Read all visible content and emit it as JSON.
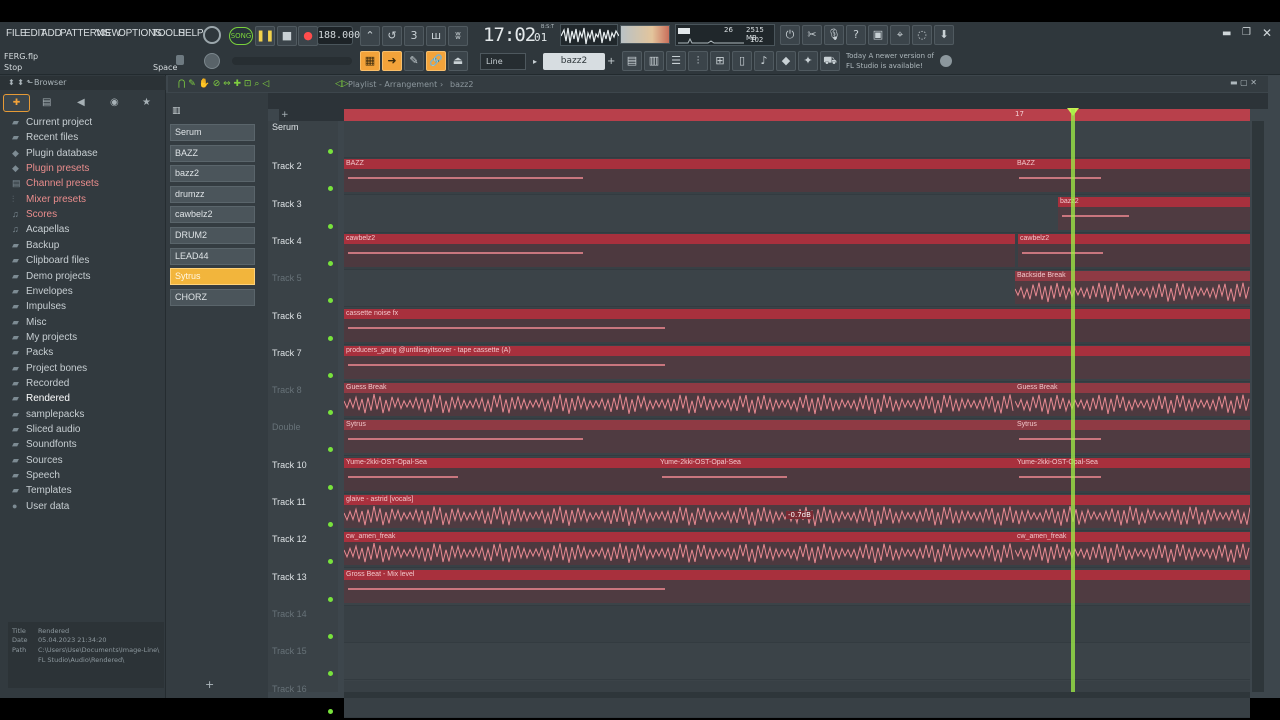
{
  "menu": [
    "FILE",
    "EDIT",
    "ADD",
    "PATTERNS",
    "VIEW",
    "OPTIONS",
    "TOOLS",
    "HELP"
  ],
  "transport": {
    "mode": "SONG",
    "tempo": "188.000",
    "time_main": "17:02",
    "time_sub": "01",
    "time_label": "B:S:T",
    "cpu": "26",
    "memory": "2515 MB",
    "polyphony": "102"
  },
  "hint": {
    "file": "FERG.flp",
    "action": "Stop",
    "shortcut": "Space"
  },
  "hint_panel": {
    "line1": "Today  A newer version of",
    "line2": "FL Studio is available!"
  },
  "snap": {
    "value": "Line"
  },
  "pattern_selector": {
    "value": "bazz2"
  },
  "browser": {
    "title": "Browser",
    "items": [
      {
        "label": "Current project",
        "icon": "folder-icon",
        "hl": false
      },
      {
        "label": "Recent files",
        "icon": "folder-icon",
        "hl": false
      },
      {
        "label": "Plugin database",
        "icon": "plugin-icon",
        "hl": false
      },
      {
        "label": "Plugin presets",
        "icon": "plugin-icon",
        "hl": true
      },
      {
        "label": "Channel presets",
        "icon": "channel-icon",
        "hl": true
      },
      {
        "label": "Mixer presets",
        "icon": "mixer-icon",
        "hl": true
      },
      {
        "label": "Scores",
        "icon": "music-icon",
        "hl": true
      },
      {
        "label": "Acapellas",
        "icon": "music-icon",
        "hl": false
      },
      {
        "label": "Backup",
        "icon": "folder-icon",
        "hl": false
      },
      {
        "label": "Clipboard files",
        "icon": "folder-icon",
        "hl": false
      },
      {
        "label": "Demo projects",
        "icon": "folder-icon",
        "hl": false
      },
      {
        "label": "Envelopes",
        "icon": "folder-icon",
        "hl": false
      },
      {
        "label": "Impulses",
        "icon": "folder-icon",
        "hl": false
      },
      {
        "label": "Misc",
        "icon": "folder-icon",
        "hl": false
      },
      {
        "label": "My projects",
        "icon": "folder-icon",
        "hl": false
      },
      {
        "label": "Packs",
        "icon": "folder-icon",
        "hl": false
      },
      {
        "label": "Project bones",
        "icon": "folder-icon",
        "hl": false
      },
      {
        "label": "Recorded",
        "icon": "folder-icon",
        "hl": false
      },
      {
        "label": "Rendered",
        "icon": "folder-icon",
        "hl": false,
        "sel": true
      },
      {
        "label": "samplepacks",
        "icon": "folder-icon",
        "hl": false
      },
      {
        "label": "Sliced audio",
        "icon": "folder-icon",
        "hl": false
      },
      {
        "label": "Soundfonts",
        "icon": "folder-icon",
        "hl": false
      },
      {
        "label": "Sources",
        "icon": "folder-icon",
        "hl": false
      },
      {
        "label": "Speech",
        "icon": "folder-icon",
        "hl": false
      },
      {
        "label": "Templates",
        "icon": "folder-icon",
        "hl": false
      },
      {
        "label": "User data",
        "icon": "user-icon",
        "hl": false
      }
    ],
    "info": {
      "title_label": "Title",
      "title_value": "Rendered",
      "date_label": "Date",
      "date_value": "05.04.2023 21:34:20",
      "path_label": "Path",
      "path_value1": "C:\\Users\\Use\\Documents\\Image-Line\\",
      "path_value2": "FL Studio\\Audio\\Rendered\\"
    }
  },
  "patterns": [
    "Serum",
    "BAZZ",
    "bazz2",
    "drumzz",
    "cawbelz2",
    "DRUM2",
    "LEAD44",
    "Sytrus",
    "CHORZ"
  ],
  "selected_pattern": "Sytrus",
  "playlist": {
    "title": "Playlist - Arrangement",
    "crumb": "bazz2",
    "ruler_marker": "17",
    "tracks": [
      "Serum",
      "Track 2",
      "Track 3",
      "Track 4",
      "Track 5",
      "Track 6",
      "Track 7",
      "Track 8",
      "Double",
      "Track 10",
      "Track 11",
      "Track 12",
      "Track 13",
      "Track 14",
      "Track 15",
      "Track 16"
    ],
    "clip_labels": {
      "bazz": "BAZZ",
      "bazz2": "bazz2",
      "cawbelz2": "cawbelz2",
      "backside": "Backside Break",
      "cassette": "cassette noise fx",
      "producers": "producers_gang @untilisayitsover - tape cassette (A)",
      "guess": "Guess Break",
      "sytrus": "Sytrus",
      "yume": "Yume-2kki-OST-Opal-Sea",
      "opal": "Opal-Sea",
      "glaive": "glaive - astrid [vocals]",
      "amen": "cw_amen_freak",
      "gross": "Gross Beat - Mix level",
      "gain": "-0.7dB"
    }
  }
}
